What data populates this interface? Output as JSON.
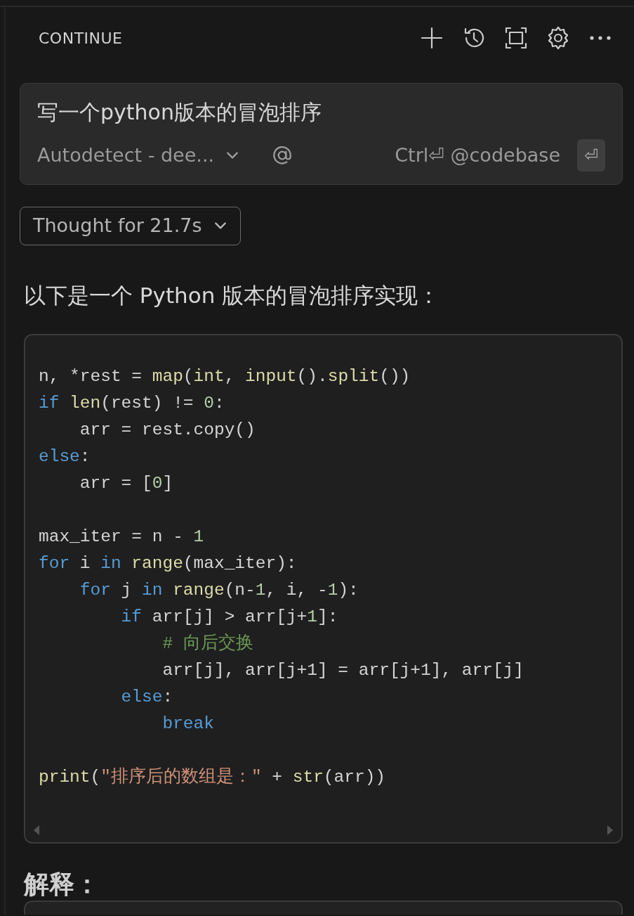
{
  "header": {
    "title": "CONTINUE"
  },
  "prompt": {
    "text": "写一个python版本的冒泡排序",
    "model": "Autodetect - dee...",
    "shortcut": "Ctrl⏎ @codebase",
    "enter_key": "⏎"
  },
  "thought": {
    "label": "Thought for 21.7s",
    "expanded": false
  },
  "intro": "以下是一个 Python 版本的冒泡排序实现：",
  "code_lines": [
    {
      "kind": "code",
      "tokens": [
        {
          "kind": "plain",
          "text": "n, *rest = "
        },
        {
          "kind": "func",
          "text": "map"
        },
        {
          "kind": "plain",
          "text": "("
        },
        {
          "kind": "type",
          "text": "int"
        },
        {
          "kind": "plain",
          "text": ", "
        },
        {
          "kind": "func",
          "text": "input"
        },
        {
          "kind": "plain",
          "text": "()."
        },
        {
          "kind": "func",
          "text": "split"
        },
        {
          "kind": "plain",
          "text": "())"
        }
      ]
    },
    {
      "kind": "code",
      "tokens": [
        {
          "kind": "keyword",
          "text": "if"
        },
        {
          "kind": "func",
          "text": " len"
        },
        {
          "kind": "plain",
          "text": "(rest) != "
        },
        {
          "kind": "number",
          "text": "0"
        },
        {
          "kind": "plain",
          "text": ":"
        }
      ]
    },
    {
      "kind": "code",
      "tokens": [
        {
          "kind": "plain",
          "text": "    arr = rest.copy()"
        }
      ]
    },
    {
      "kind": "code",
      "tokens": [
        {
          "kind": "keyword",
          "text": "else"
        },
        {
          "kind": "plain",
          "text": ":"
        }
      ]
    },
    {
      "kind": "code",
      "tokens": [
        {
          "kind": "plain",
          "text": "    arr = ["
        },
        {
          "kind": "number",
          "text": "0"
        },
        {
          "kind": "plain",
          "text": "]"
        }
      ]
    },
    {
      "kind": "blank"
    },
    {
      "kind": "code",
      "tokens": [
        {
          "kind": "plain",
          "text": "max_iter = n - "
        },
        {
          "kind": "number",
          "text": "1"
        }
      ]
    },
    {
      "kind": "code",
      "tokens": [
        {
          "kind": "keyword",
          "text": "for"
        },
        {
          "kind": "plain",
          "text": " i "
        },
        {
          "kind": "keyword",
          "text": "in"
        },
        {
          "kind": "func",
          "text": " range"
        },
        {
          "kind": "plain",
          "text": "(max_iter):"
        }
      ]
    },
    {
      "kind": "code",
      "tokens": [
        {
          "kind": "keyword",
          "text": "    for"
        },
        {
          "kind": "plain",
          "text": " j "
        },
        {
          "kind": "keyword",
          "text": "in"
        },
        {
          "kind": "func",
          "text": " range"
        },
        {
          "kind": "plain",
          "text": "(n-"
        },
        {
          "kind": "number",
          "text": "1"
        },
        {
          "kind": "plain",
          "text": ", i, -"
        },
        {
          "kind": "number",
          "text": "1"
        },
        {
          "kind": "plain",
          "text": "):"
        }
      ]
    },
    {
      "kind": "code",
      "tokens": [
        {
          "kind": "keyword",
          "text": "        if"
        },
        {
          "kind": "plain",
          "text": " arr[j] > arr[j+"
        },
        {
          "kind": "number",
          "text": "1"
        },
        {
          "kind": "plain",
          "text": "]:"
        }
      ]
    },
    {
      "kind": "code",
      "tokens": [
        {
          "kind": "comment",
          "text": "            # 向后交换"
        }
      ]
    },
    {
      "kind": "code",
      "tokens": [
        {
          "kind": "plain",
          "text": "            arr[j], arr[j+1] = arr[j+1], arr[j]"
        }
      ]
    },
    {
      "kind": "code",
      "tokens": [
        {
          "kind": "keyword",
          "text": "        else"
        },
        {
          "kind": "plain",
          "text": ":"
        }
      ]
    },
    {
      "kind": "code",
      "tokens": [
        {
          "kind": "keyword",
          "text": "            break"
        }
      ]
    },
    {
      "kind": "blank"
    },
    {
      "kind": "code",
      "tokens": [
        {
          "kind": "func",
          "text": "print"
        },
        {
          "kind": "plain",
          "text": "("
        },
        {
          "kind": "string",
          "text": "\"排序后的数组是：\""
        },
        {
          "kind": "plain",
          "text": " + "
        },
        {
          "kind": "func",
          "text": "str"
        },
        {
          "kind": "plain",
          "text": "(arr))"
        }
      ]
    }
  ],
  "section_heading": "解释："
}
